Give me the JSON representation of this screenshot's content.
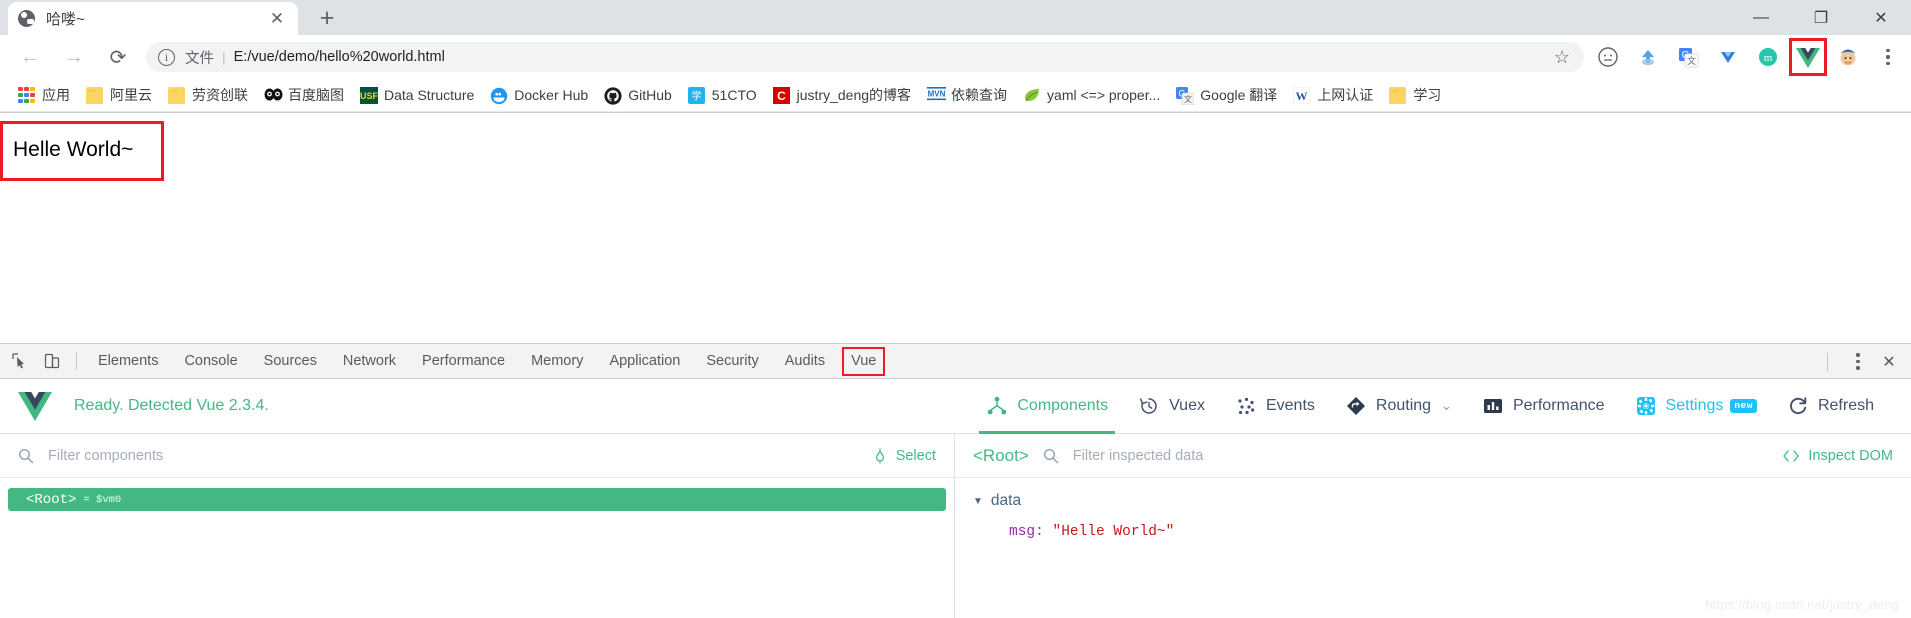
{
  "window": {
    "controls": [
      {
        "name": "minimize",
        "glyph": "—"
      },
      {
        "name": "maximize",
        "glyph": "❐"
      },
      {
        "name": "close",
        "glyph": "✕"
      }
    ]
  },
  "tab": {
    "title": "哈喽~",
    "close_glyph": "✕",
    "newtab_glyph": "+",
    "favicon": "globe-icon"
  },
  "toolbar": {
    "back_glyph": "←",
    "forward_glyph": "→",
    "reload_glyph": "⟳",
    "info_glyph": "i",
    "url_scheme": "文件",
    "url_separator": "|",
    "url": "E:/vue/demo/hello%20world.html",
    "star_glyph": "☆",
    "extensions": [
      {
        "name": "emoji-extension-icon",
        "highlight": false
      },
      {
        "name": "cloud-upload-extension-icon",
        "highlight": false
      },
      {
        "name": "google-translate-extension-icon",
        "highlight": false
      },
      {
        "name": "diamond-extension-icon",
        "highlight": false
      },
      {
        "name": "momentum-extension-icon",
        "highlight": false
      },
      {
        "name": "vue-devtools-extension-icon",
        "highlight": true
      },
      {
        "name": "avatar-profile-icon",
        "highlight": false
      }
    ],
    "menu_glyph": "kebab"
  },
  "bookmarks": [
    {
      "label": "应用",
      "icon": "apps-grid-icon"
    },
    {
      "label": "阿里云",
      "icon": "folder-icon"
    },
    {
      "label": "劳资创联",
      "icon": "folder-icon"
    },
    {
      "label": "百度脑图",
      "icon": "baidu-naotu-icon"
    },
    {
      "label": "Data Structure",
      "icon": "usf-icon"
    },
    {
      "label": "Docker Hub",
      "icon": "docker-icon"
    },
    {
      "label": "GitHub",
      "icon": "github-icon"
    },
    {
      "label": "51CTO",
      "icon": "51cto-icon"
    },
    {
      "label": "justry_deng的博客",
      "icon": "csdn-icon"
    },
    {
      "label": "依赖查询",
      "icon": "maven-icon"
    },
    {
      "label": "yaml <=> proper...",
      "icon": "leaf-icon"
    },
    {
      "label": "Google 翻译",
      "icon": "google-translate-icon"
    },
    {
      "label": "上网认证",
      "icon": "word-icon"
    },
    {
      "label": "学习",
      "icon": "folder-icon"
    }
  ],
  "page": {
    "hello_text": "Helle World~",
    "highlight_color": "#ee1b24"
  },
  "devtools": {
    "inspect_glyph": "inspect-element-icon",
    "device_glyph": "device-toolbar-icon",
    "tabs": [
      {
        "label": "Elements",
        "active": false,
        "boxed": false
      },
      {
        "label": "Console",
        "active": false,
        "boxed": false
      },
      {
        "label": "Sources",
        "active": false,
        "boxed": false
      },
      {
        "label": "Network",
        "active": false,
        "boxed": false
      },
      {
        "label": "Performance",
        "active": false,
        "boxed": false
      },
      {
        "label": "Memory",
        "active": false,
        "boxed": false
      },
      {
        "label": "Application",
        "active": false,
        "boxed": false
      },
      {
        "label": "Security",
        "active": false,
        "boxed": false
      },
      {
        "label": "Audits",
        "active": false,
        "boxed": false
      },
      {
        "label": "Vue",
        "active": true,
        "boxed": true
      }
    ],
    "more_glyph": "kebab",
    "close_glyph": "✕"
  },
  "vue": {
    "status": "Ready. Detected Vue 2.3.4.",
    "status_color": "#42b983",
    "nav": [
      {
        "label": "Components",
        "icon": "components-icon",
        "active": true
      },
      {
        "label": "Vuex",
        "icon": "vuex-clock-icon",
        "active": false
      },
      {
        "label": "Events",
        "icon": "events-dots-icon",
        "active": false
      },
      {
        "label": "Routing",
        "icon": "routing-diamond-icon",
        "active": false,
        "chevron": "⌄"
      },
      {
        "label": "Performance",
        "icon": "performance-bars-icon",
        "active": false
      },
      {
        "label": "Settings",
        "icon": "settings-gear-icon",
        "active": false,
        "badge": "new",
        "accent": "#1fc2f7"
      },
      {
        "label": "Refresh",
        "icon": "refresh-icon",
        "active": false
      }
    ],
    "left": {
      "filter_placeholder": "Filter components",
      "search_icon": "search-icon",
      "select_label": "Select",
      "select_icon": "target-icon",
      "tree": [
        {
          "tag": "<Root>",
          "vm": "= $vm0",
          "selected": true
        }
      ]
    },
    "right": {
      "root_label": "<Root>",
      "filter_placeholder": "Filter inspected data",
      "search_icon": "search-icon",
      "inspect_dom_label": "Inspect DOM",
      "inspect_dom_icon": "code-brackets-icon",
      "groups": [
        {
          "name": "data",
          "caret": "▼",
          "rows": [
            {
              "key": "msg",
              "sep": ": ",
              "value": "\"Helle World~\""
            }
          ]
        }
      ]
    }
  },
  "watermark": "https://blog.csdn.net/justry_deng"
}
